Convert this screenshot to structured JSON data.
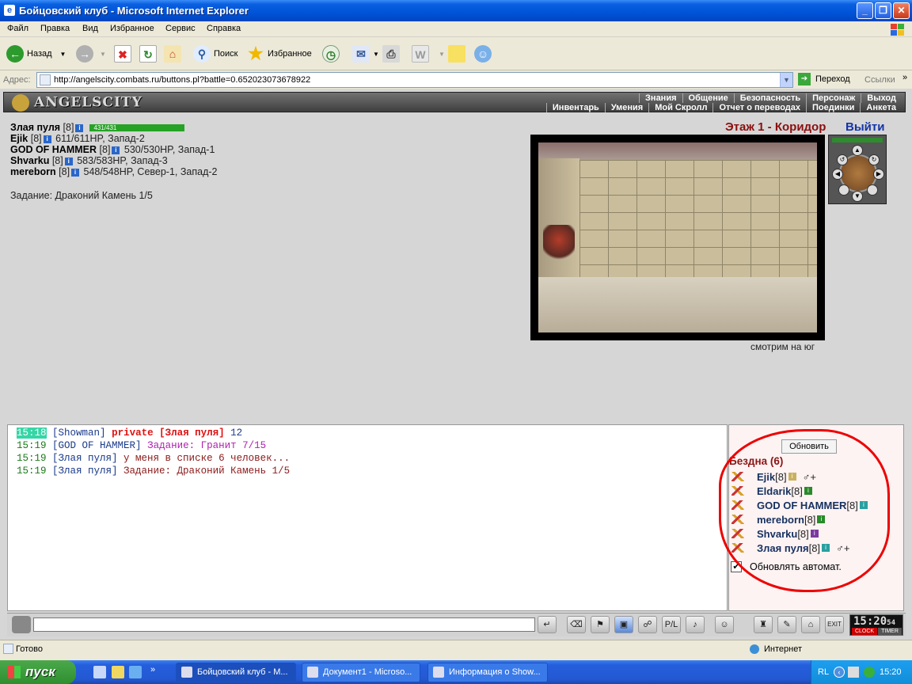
{
  "window": {
    "title": "Бойцовский клуб - Microsoft Internet Explorer"
  },
  "menu": [
    "Файл",
    "Правка",
    "Вид",
    "Избранное",
    "Сервис",
    "Справка"
  ],
  "toolbar": {
    "back": "Назад",
    "search": "Поиск",
    "favorites": "Избранное"
  },
  "address": {
    "label": "Адрес:",
    "url": "http://angelscity.combats.ru/buttons.pl?battle=0.652023073678922",
    "go": "Переход",
    "links": "Ссылки"
  },
  "game": {
    "logo": "ANGELSCITY",
    "menu_top": [
      "Знания",
      "Общение",
      "Безопасность",
      "Персонаж",
      "Выход"
    ],
    "menu_bottom": [
      "Инвентарь",
      "Умения",
      "Мой Скролл",
      "Отчет о переводах",
      "Поединки",
      "Анкета"
    ],
    "me": {
      "name": "Злая пуля",
      "level": "[8]",
      "hp": "431/431",
      "hp_fraction": 1.0
    },
    "party": [
      {
        "name": "Ejik",
        "level": "[8]",
        "info": "611/611HP, Запад-2"
      },
      {
        "name": "GOD OF HAMMER",
        "level": "[8]",
        "info": "530/530HP, Запад-1"
      },
      {
        "name": "Shvarku",
        "level": "[8]",
        "info": "583/583HP, Запад-3"
      },
      {
        "name": "mereborn",
        "level": "[8]",
        "info": "548/548HP, Север-1, Запад-2"
      }
    ],
    "mission": "Задание: Драконий Камень 1/5",
    "location": "Этаж 1 - Коридор",
    "exit": "Выйти",
    "direction": "смотрим на юг"
  },
  "chat": [
    {
      "time": "15:18",
      "highlight": true,
      "user": "[Showman]",
      "private": "private [Злая пуля]",
      "text": " 12",
      "text_color": "#1a3a8a"
    },
    {
      "time": "15:19",
      "highlight": false,
      "user": "[GOD OF HAMMER]",
      "private": "",
      "text": " Задание: Гранит 7/15",
      "text_color": "#b020b0"
    },
    {
      "time": "15:19",
      "highlight": false,
      "user": "[Злая пуля]",
      "private": "",
      "text": " у меня в списке 6 человек...",
      "text_color": "#8b1a1a"
    },
    {
      "time": "15:19",
      "highlight": false,
      "user": "[Злая пуля]",
      "private": "",
      "text": " Задание: Драконий Камень 1/5",
      "text_color": "#8b1a1a"
    }
  ],
  "sidebar": {
    "refresh": "Обновить",
    "room": "Бездна (6)",
    "users": [
      {
        "name": "Ejik",
        "level": "[8]",
        "info_color": "#c8b060",
        "friend": "♂+"
      },
      {
        "name": "Eldarik",
        "level": "[8]",
        "info_color": "#2a8a2a",
        "friend": ""
      },
      {
        "name": "GOD OF HAMMER",
        "level": "[8]",
        "info_color": "#2aa0a0",
        "friend": ""
      },
      {
        "name": "mereborn",
        "level": "[8]",
        "info_color": "#2a8a2a",
        "friend": ""
      },
      {
        "name": "Shvarku",
        "level": "[8]",
        "info_color": "#7a3aa0",
        "friend": ""
      },
      {
        "name": "Злая пуля",
        "level": "[8]",
        "info_color": "#2aa0a0",
        "friend": "♂+"
      }
    ],
    "autorefresh": "Обновлять автомат.",
    "autorefresh_checked": true
  },
  "clock": {
    "time": "15:20",
    "sec": "54",
    "clock_label": "CLOCK",
    "timer_label": "TIMER"
  },
  "status": {
    "text": "Готово",
    "zone": "Интернет"
  },
  "taskbar": {
    "start": "пуск",
    "tasks": [
      "Бойцовский клуб - М...",
      "Документ1 - Microso...",
      "Информация о Show..."
    ],
    "lang": "RL",
    "time": "15:20"
  }
}
